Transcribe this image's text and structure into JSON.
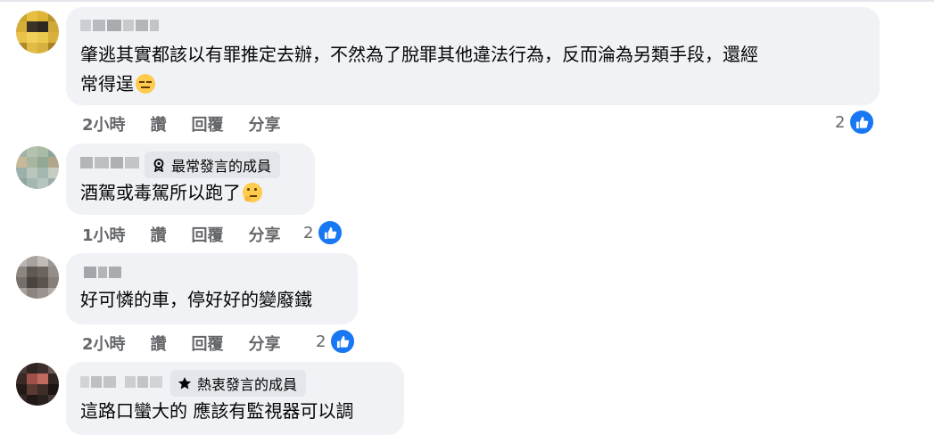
{
  "comments": [
    {
      "author": "已遮蔽的名稱",
      "badge": "",
      "text_lines": [
        "肇逃其實都該以有罪推定去辦，不然為了脫罪其他違法行為，反而淪為另類手段，還經",
        "常得逞"
      ],
      "emoji": "expressionless-face",
      "time": "2小時",
      "like_label": "讚",
      "reply_label": "回覆",
      "share_label": "分享",
      "reaction_count": "2",
      "reaction_icon": "thumbs-up-icon"
    },
    {
      "author": "已遮蔽的名稱",
      "badge": "最常發言的成員",
      "badge_icon": "medal-icon",
      "text_lines": [
        "酒駕或毒駕所以跑了"
      ],
      "emoji": "thinking-face",
      "time": "1小時",
      "like_label": "讚",
      "reply_label": "回覆",
      "share_label": "分享",
      "reaction_count": "2",
      "reaction_icon": "thumbs-up-icon"
    },
    {
      "author": "已遮蔽的名稱",
      "badge": "",
      "text_lines": [
        "好可憐的車，停好好的變廢鐵"
      ],
      "emoji": "",
      "time": "2小時",
      "like_label": "讚",
      "reply_label": "回覆",
      "share_label": "分享",
      "reaction_count": "2",
      "reaction_icon": "thumbs-up-icon"
    },
    {
      "author": "已遮蔽的名稱",
      "badge": "熱衷發言的成員",
      "badge_icon": "star-icon",
      "text_lines": [
        "這路口蠻大的 應該有監視器可以調"
      ],
      "emoji": ""
    }
  ],
  "colors": {
    "bubble": "#f0f2f5",
    "badge": "#e4e6eb",
    "meta_text": "#65676b",
    "like_blue": "#1877f2",
    "text": "#050505"
  }
}
